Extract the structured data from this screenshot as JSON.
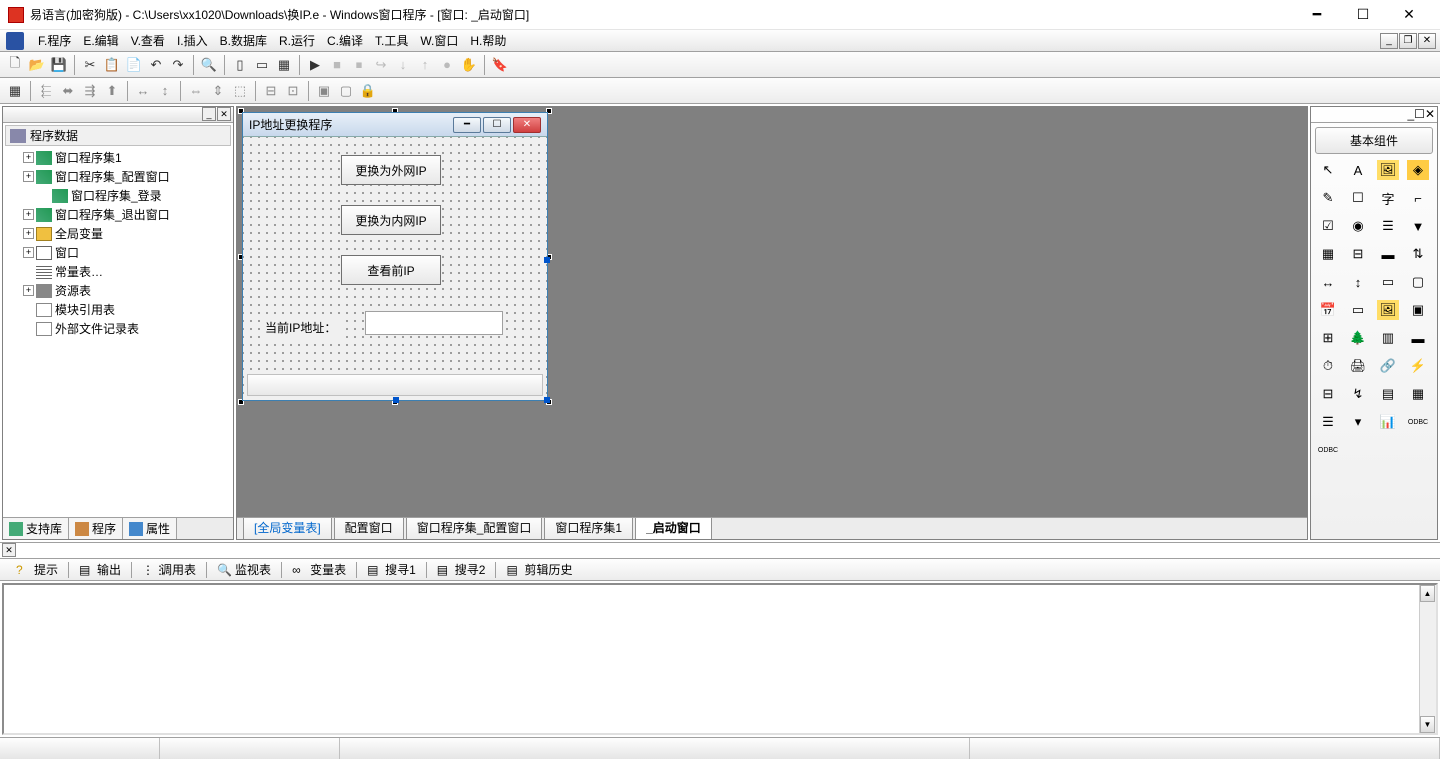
{
  "title": "易语言(加密狗版) - C:\\Users\\xx1020\\Downloads\\换IP.e - Windows窗口程序 - [窗口: _启动窗口]",
  "menu": {
    "program": "F.程序",
    "edit": "E.编辑",
    "view": "V.查看",
    "insert": "I.插入",
    "database": "B.数据库",
    "run": "R.运行",
    "compile": "C.编译",
    "tools": "T.工具",
    "window": "W.窗口",
    "help": "H.帮助"
  },
  "tree": {
    "root": "程序数据",
    "items": [
      {
        "label": "窗口程序集1",
        "icon": "layers",
        "exp": true,
        "indent": 1
      },
      {
        "label": "窗口程序集_配置窗口",
        "icon": "layers",
        "exp": true,
        "indent": 1
      },
      {
        "label": "窗口程序集_登录",
        "icon": "layers",
        "exp": false,
        "indent": 2
      },
      {
        "label": "窗口程序集_退出窗口",
        "icon": "layers",
        "exp": true,
        "indent": 1
      },
      {
        "label": "全局变量",
        "icon": "box",
        "exp": true,
        "indent": 1
      },
      {
        "label": "窗口",
        "icon": "win",
        "exp": true,
        "indent": 1
      },
      {
        "label": "常量表…",
        "icon": "grid",
        "exp": false,
        "indent": 1
      },
      {
        "label": "资源表",
        "icon": "link",
        "exp": true,
        "indent": 1
      },
      {
        "label": "模块引用表",
        "icon": "doc",
        "exp": false,
        "indent": 1
      },
      {
        "label": "外部文件记录表",
        "icon": "doc",
        "exp": false,
        "indent": 1
      }
    ]
  },
  "left_tabs": {
    "support": "支持库",
    "program": "程序",
    "props": "属性"
  },
  "form": {
    "title": "IP地址更换程序",
    "btn1": "更换为外网IP",
    "btn2": "更换为内网IP",
    "btn3": "查看前IP",
    "label": "当前IP地址："
  },
  "center_tabs": {
    "t0": "[全局变量表]",
    "t1": "配置窗口",
    "t2": "窗口程序集_配置窗口",
    "t3": "窗口程序集1",
    "t4": "_启动窗口"
  },
  "right": {
    "title": "基本组件"
  },
  "bottom_tabs": {
    "hint": "提示",
    "output": "输出",
    "calltable": "调用表",
    "watch": "监视表",
    "vars": "变量表",
    "search1": "搜寻1",
    "search2": "搜寻2",
    "cliphistory": "剪辑历史"
  }
}
